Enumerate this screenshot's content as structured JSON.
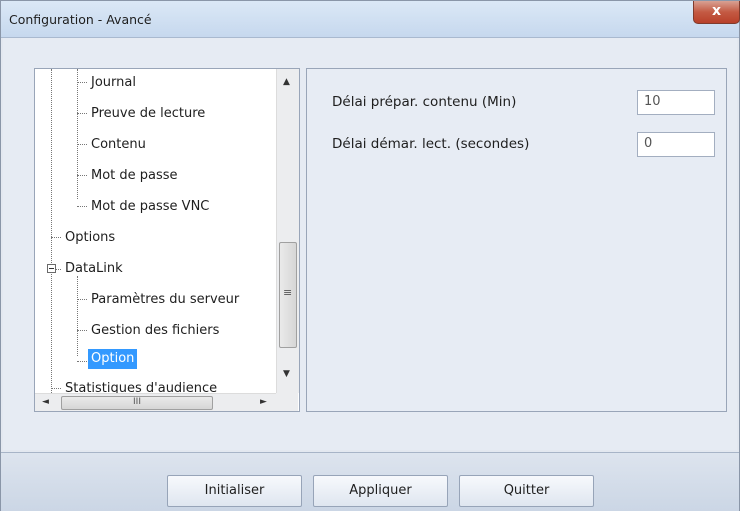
{
  "window": {
    "title": "Configuration - Avancé",
    "close_label": "x"
  },
  "tree": {
    "items": [
      {
        "label": "Journal"
      },
      {
        "label": "Preuve de lecture"
      },
      {
        "label": "Contenu"
      },
      {
        "label": "Mot de passe"
      },
      {
        "label": "Mot de passe VNC"
      },
      {
        "label": "Options"
      },
      {
        "label": "DataLink"
      },
      {
        "label": "Paramètres du serveur"
      },
      {
        "label": "Gestion des fichiers"
      },
      {
        "label": "Option",
        "selected": true
      },
      {
        "label": "Statistiques d'audience"
      }
    ],
    "scroll_up": "▲",
    "scroll_down": "▼",
    "scroll_left": "◄",
    "scroll_right": "►",
    "hthumb_grip": "III",
    "vthumb_grip": "≡"
  },
  "settings": {
    "fields": [
      {
        "label": "Délai prépar. contenu (Min)",
        "value": "10"
      },
      {
        "label": "Délai démar. lect. (secondes)",
        "value": "0"
      }
    ]
  },
  "buttons": {
    "reset": "Initialiser",
    "apply": "Appliquer",
    "quit": "Quitter"
  }
}
